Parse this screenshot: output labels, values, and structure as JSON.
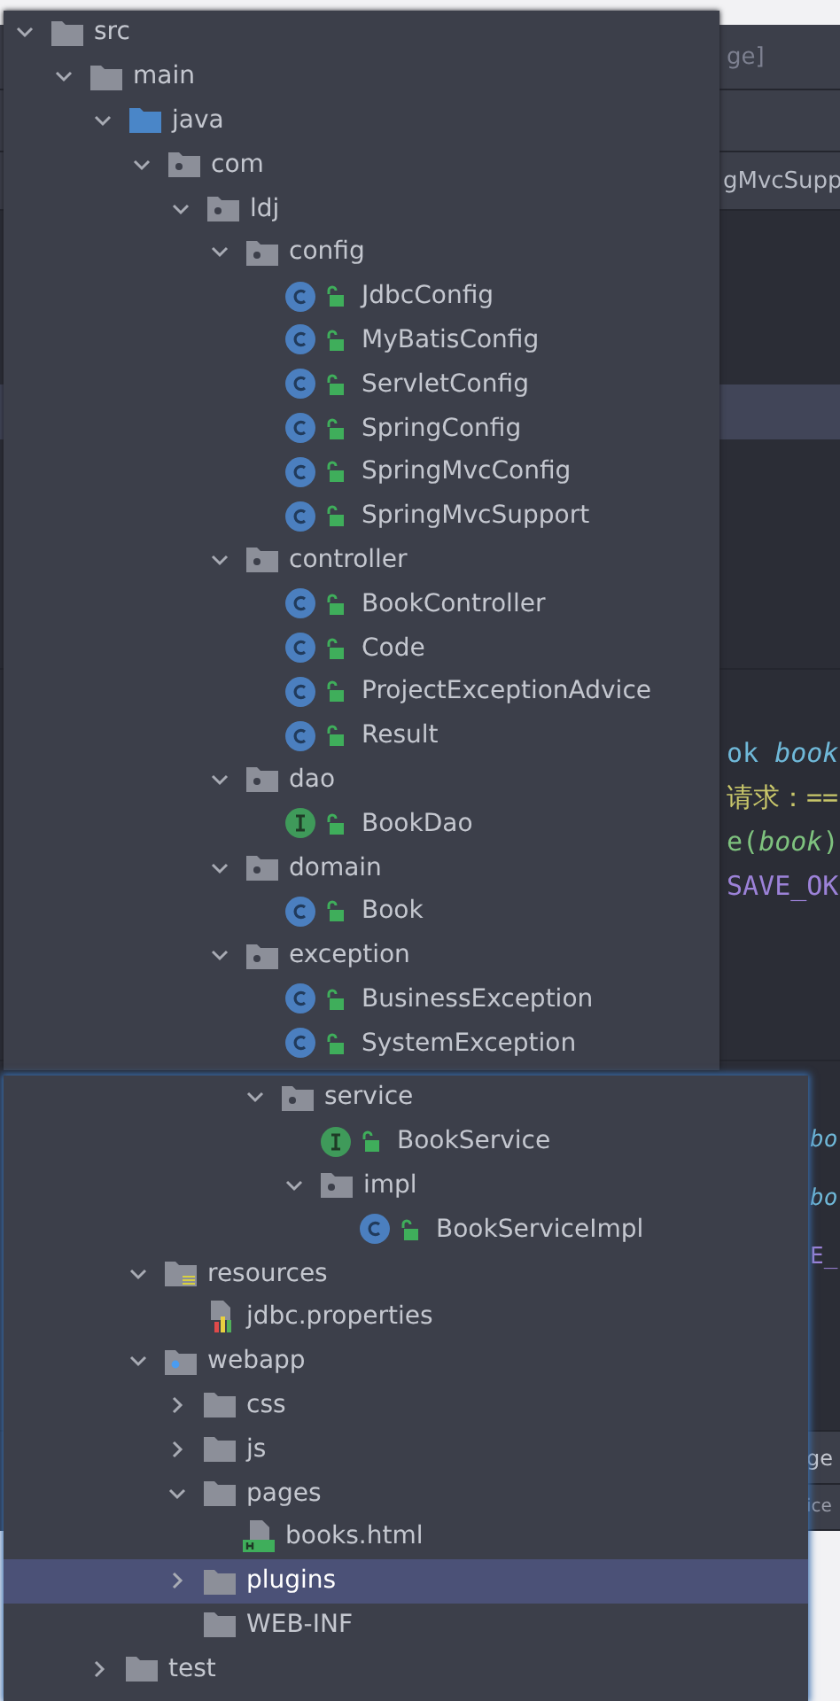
{
  "editor": {
    "title_fragment": "ge]",
    "tab_fragment": "gMvcSupp",
    "upper_code": [
      {
        "text": "ok *book*",
        "kind": "declaration"
      },
      {
        "text": "请求：==",
        "kind": "string"
      },
      {
        "text": "e(*book*)",
        "kind": "call"
      },
      {
        "text": "SAVE_OK",
        "kind": "constant"
      }
    ],
    "lower_code": [
      {
        "text": "*bo*",
        "kind": "declaration"
      },
      {
        "text": "*bo*",
        "kind": "declaration"
      },
      {
        "text": "E_",
        "kind": "constant"
      }
    ],
    "lower_tabs": [
      "ge",
      "ice"
    ]
  },
  "tree": [
    {
      "label": "src",
      "kind": "folder",
      "expanded": true,
      "selected": false,
      "children": [
        {
          "label": "main",
          "kind": "folder",
          "expanded": true,
          "selected": false,
          "children": [
            {
              "label": "java",
              "kind": "source-folder",
              "expanded": true,
              "selected": false,
              "children": [
                {
                  "label": "com",
                  "kind": "package",
                  "expanded": true,
                  "selected": false,
                  "children": [
                    {
                      "label": "ldj",
                      "kind": "package",
                      "expanded": true,
                      "selected": false,
                      "children": [
                        {
                          "label": "config",
                          "kind": "package",
                          "expanded": true,
                          "selected": false,
                          "children": [
                            {
                              "label": "JdbcConfig",
                              "kind": "class",
                              "selected": false
                            },
                            {
                              "label": "MyBatisConfig",
                              "kind": "class",
                              "selected": false
                            },
                            {
                              "label": "ServletConfig",
                              "kind": "class",
                              "selected": false
                            },
                            {
                              "label": "SpringConfig",
                              "kind": "class",
                              "selected": false
                            },
                            {
                              "label": "SpringMvcConfig",
                              "kind": "class",
                              "selected": false
                            },
                            {
                              "label": "SpringMvcSupport",
                              "kind": "class",
                              "selected": false
                            }
                          ]
                        },
                        {
                          "label": "controller",
                          "kind": "package",
                          "expanded": true,
                          "selected": false,
                          "children": [
                            {
                              "label": "BookController",
                              "kind": "class",
                              "selected": false
                            },
                            {
                              "label": "Code",
                              "kind": "class",
                              "selected": false
                            },
                            {
                              "label": "ProjectExceptionAdvice",
                              "kind": "class",
                              "selected": false
                            },
                            {
                              "label": "Result",
                              "kind": "class",
                              "selected": false
                            }
                          ]
                        },
                        {
                          "label": "dao",
                          "kind": "package",
                          "expanded": true,
                          "selected": false,
                          "children": [
                            {
                              "label": "BookDao",
                              "kind": "interface",
                              "selected": false
                            }
                          ]
                        },
                        {
                          "label": "domain",
                          "kind": "package",
                          "expanded": true,
                          "selected": false,
                          "children": [
                            {
                              "label": "Book",
                              "kind": "class",
                              "selected": false
                            }
                          ]
                        },
                        {
                          "label": "exception",
                          "kind": "package",
                          "expanded": true,
                          "selected": false,
                          "children": [
                            {
                              "label": "BusinessException",
                              "kind": "class",
                              "selected": false
                            },
                            {
                              "label": "SystemException",
                              "kind": "class",
                              "selected": false
                            }
                          ]
                        },
                        {
                          "label": "service",
                          "kind": "package",
                          "expanded": true,
                          "selected": false,
                          "starts_lower_panel": true,
                          "children": [
                            {
                              "label": "BookService",
                              "kind": "interface",
                              "selected": false
                            },
                            {
                              "label": "impl",
                              "kind": "package",
                              "expanded": true,
                              "selected": false,
                              "children": [
                                {
                                  "label": "BookServiceImpl",
                                  "kind": "class",
                                  "selected": false
                                }
                              ]
                            }
                          ]
                        }
                      ]
                    }
                  ]
                }
              ]
            },
            {
              "label": "resources",
              "kind": "resources-folder",
              "expanded": true,
              "selected": false,
              "children": [
                {
                  "label": "jdbc.properties",
                  "kind": "properties",
                  "selected": false
                }
              ]
            },
            {
              "label": "webapp",
              "kind": "web-folder",
              "expanded": true,
              "selected": false,
              "children": [
                {
                  "label": "css",
                  "kind": "folder",
                  "expanded": false,
                  "selected": false
                },
                {
                  "label": "js",
                  "kind": "folder",
                  "expanded": false,
                  "selected": false
                },
                {
                  "label": "pages",
                  "kind": "folder",
                  "expanded": true,
                  "selected": false,
                  "children": [
                    {
                      "label": "books.html",
                      "kind": "html",
                      "selected": false
                    }
                  ]
                },
                {
                  "label": "plugins",
                  "kind": "folder",
                  "expanded": false,
                  "selected": true
                },
                {
                  "label": "WEB-INF",
                  "kind": "folder",
                  "selected": false
                }
              ]
            }
          ]
        },
        {
          "label": "test",
          "kind": "folder",
          "expanded": false,
          "selected": false
        }
      ]
    }
  ]
}
